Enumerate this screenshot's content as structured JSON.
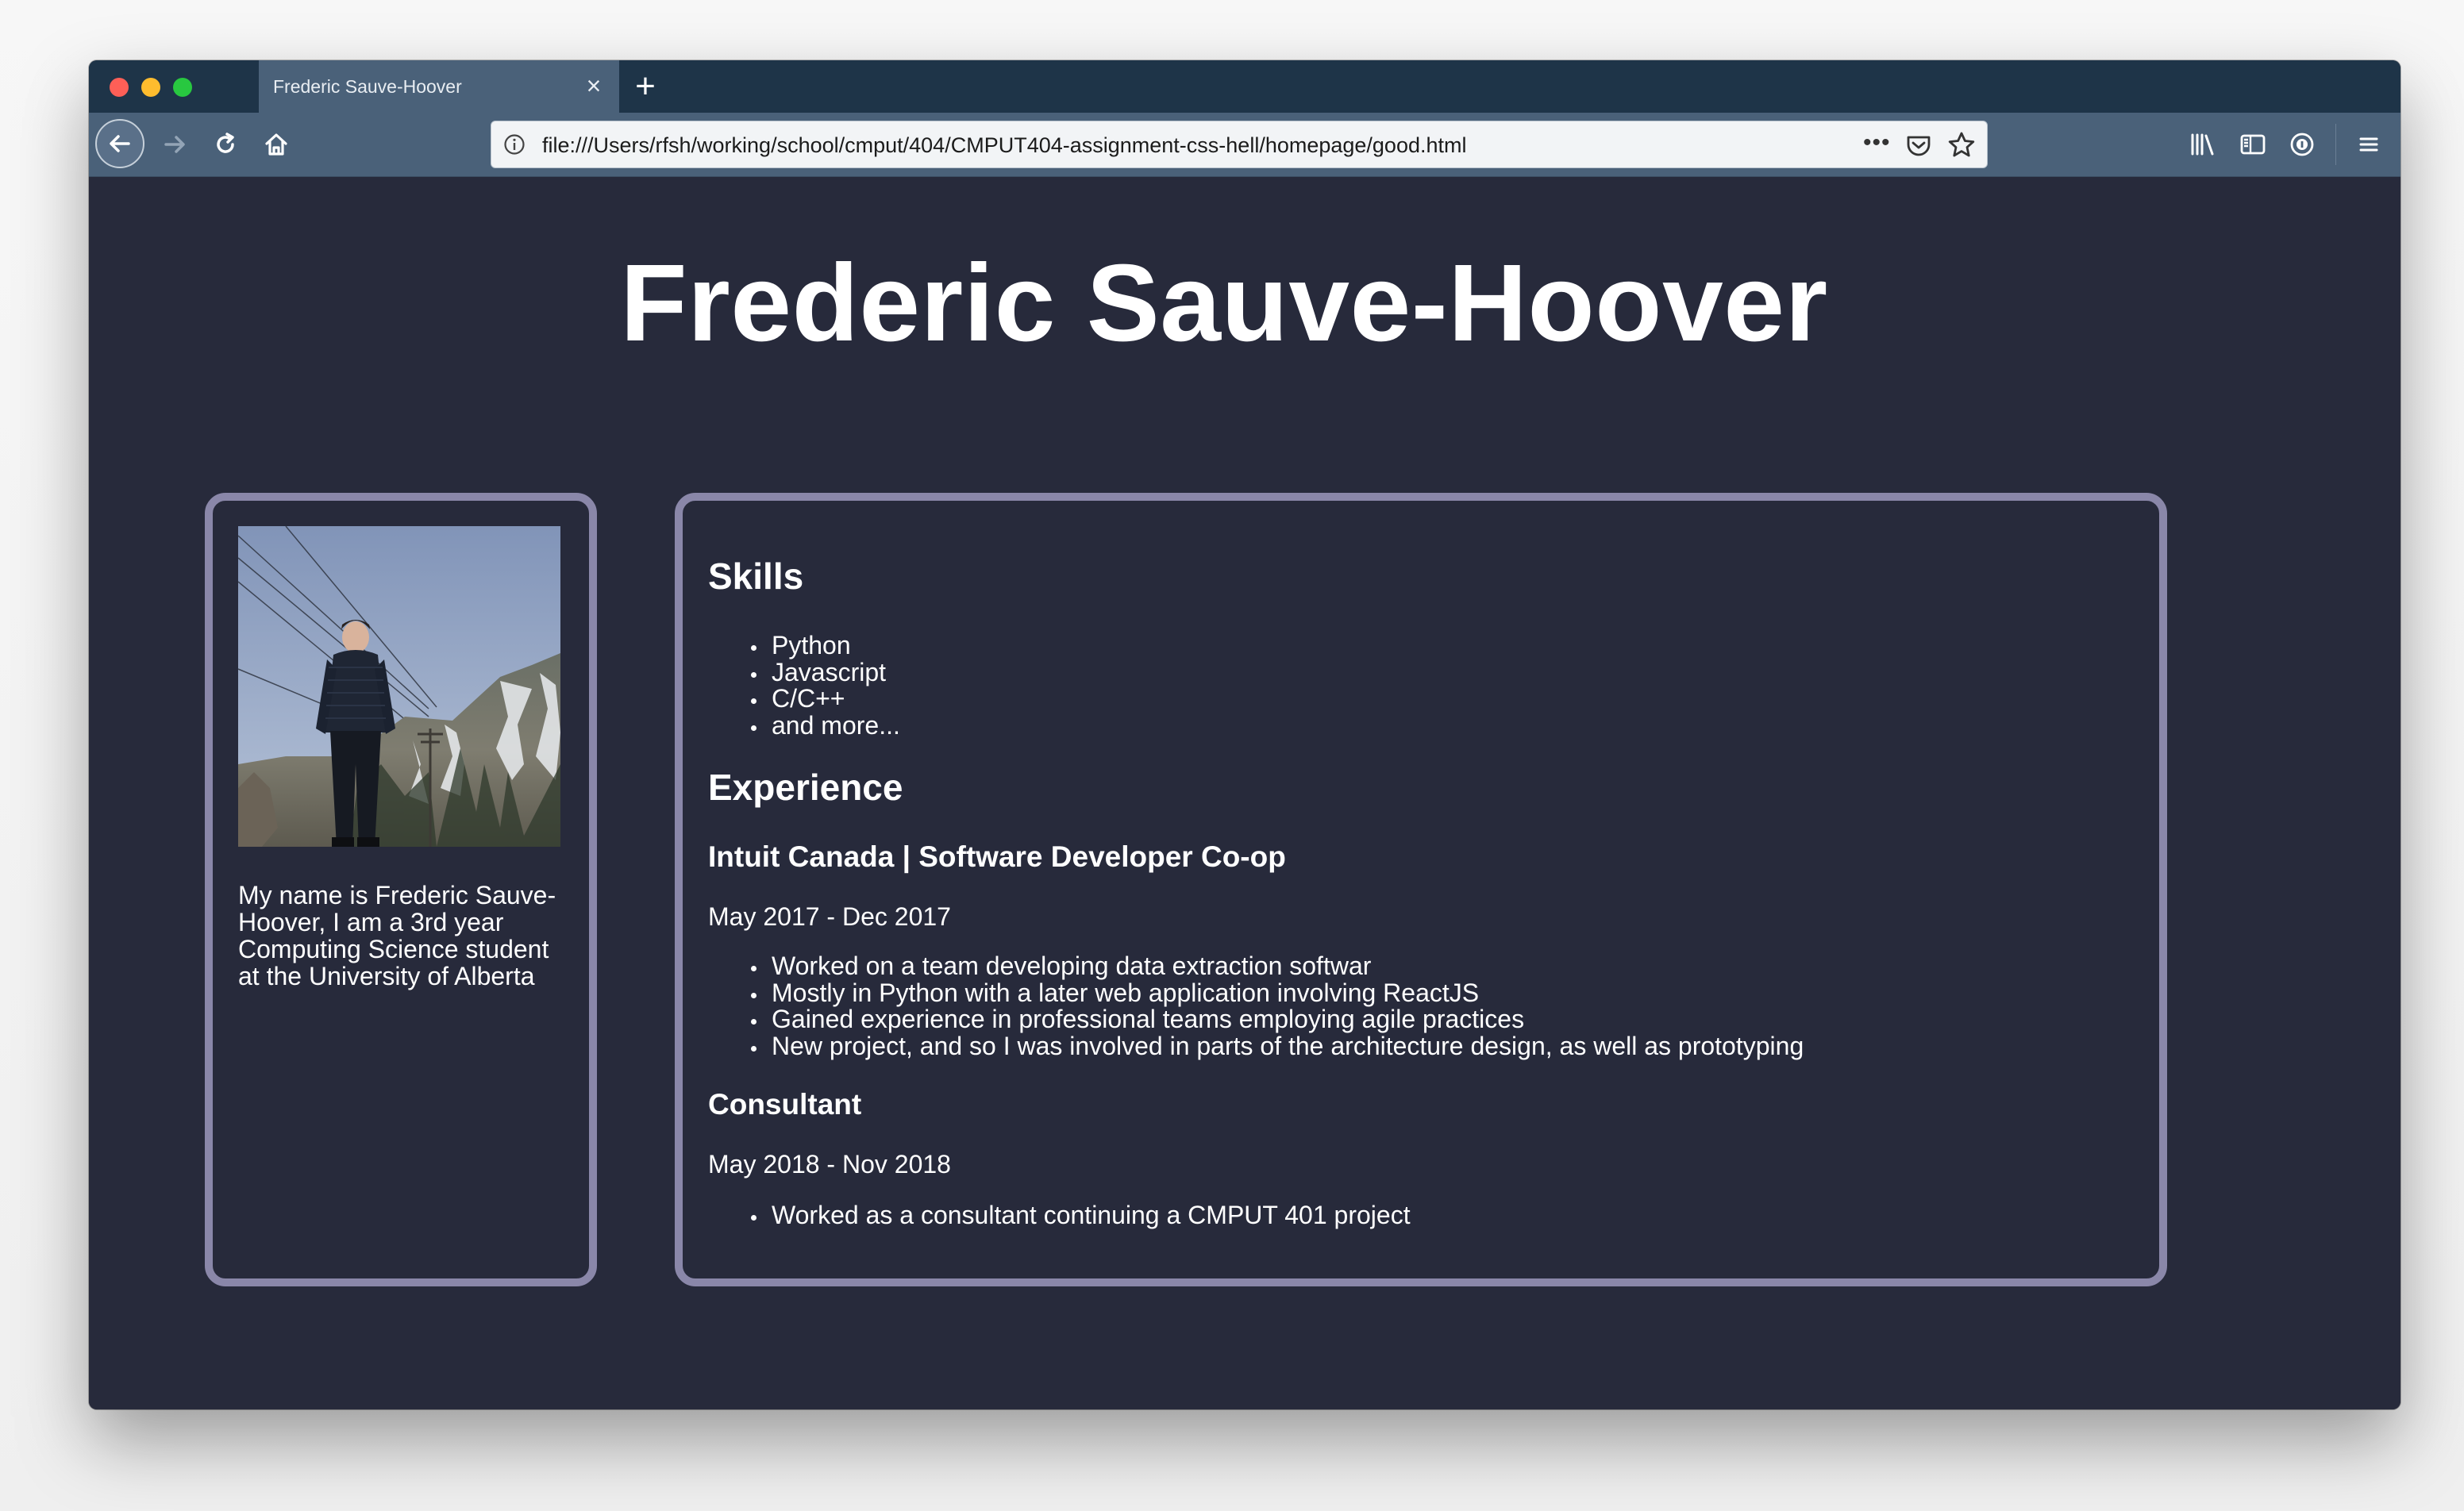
{
  "browser": {
    "tab_title": "Frederic Sauve-Hoover",
    "url": "file:///Users/rfsh/working/school/cmput/404/CMPUT404-assignment-css-hell/homepage/good.html",
    "page_actions_label": "•••",
    "toolbar_icons": [
      "back-icon",
      "forward-icon",
      "reload-icon",
      "home-icon",
      "info-icon",
      "pocket-icon",
      "star-icon",
      "library-icon",
      "sidebar-icon",
      "extension-icon",
      "hamburger-menu-icon"
    ]
  },
  "page": {
    "title": "Frederic Sauve-Hoover",
    "profile": {
      "bio": "My name is Frederic Sauve-Hoover, I am a 3rd year Computing Science student at the University of Alberta"
    },
    "skills": {
      "heading": "Skills",
      "items": [
        "Python",
        "Javascript",
        "C/C++",
        "and more..."
      ]
    },
    "experience": {
      "heading": "Experience",
      "jobs": [
        {
          "title": "Intuit Canada | Software Developer Co-op",
          "dates": "May 2017 - Dec 2017",
          "bullets": [
            "Worked on a team developing data extraction softwar",
            "Mostly in Python with a later web application involving ReactJS",
            "Gained experience in professional teams employing agile practices",
            "New project, and so I was involved in parts of the architecture design, as well as prototyping"
          ]
        },
        {
          "title": "Consultant",
          "dates": "May 2018 - Nov 2018",
          "bullets": [
            "Worked as a consultant continuing a CMPUT 401 project"
          ]
        }
      ]
    }
  },
  "colors": {
    "page_background": "#272a3b",
    "card_border": "#8a87a9",
    "text": "#ffffff",
    "tabstrip": "#1e3448",
    "toolbar": "#4a6179"
  }
}
